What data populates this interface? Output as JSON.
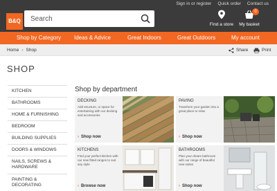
{
  "header": {
    "logo": "B&Q",
    "search_placeholder": "Search",
    "toplinks": [
      "Sign in or register",
      "Quick order",
      "Contact us"
    ],
    "find_store": "Find a store",
    "basket": "My basket",
    "basket_count": "0"
  },
  "nav": [
    "Shop by Category",
    "Ideas & Advice",
    "Great Indoors",
    "Great Outdoors",
    "My account"
  ],
  "breadcrumb": [
    "Home",
    "Shop"
  ],
  "share": "Share",
  "print": "Print",
  "page_title": "SHOP",
  "sidebar": [
    "KITCHEN",
    "BATHROOMS",
    "HOME & FURNISHING",
    "BEDROOM",
    "BUILDING SUPPLIES",
    "DOORS & WINDOWS",
    "NAILS, SCREWS & HARDWARE",
    "PAINTING & DECORATING"
  ],
  "dept_title": "Shop by department",
  "cards": [
    {
      "title": "DECKING",
      "desc": "Add structure, or space for entertaining with our decking and accessories",
      "link": "Shop now"
    },
    {
      "title": "PAVING",
      "desc": "Transform your garden into a great place to relax",
      "link": "Shop now"
    },
    {
      "title": "KITCHENS",
      "desc": "Find your perfect kitchen with our new fitted ranges to suit any style",
      "link": "Browse now"
    },
    {
      "title": "BATHROOMS",
      "desc": "Plan your dream bathroom with our range of beautiful new suites",
      "link": "Shop now"
    }
  ],
  "colors": {
    "brand": "#f26722",
    "header": "#3b3b3b"
  }
}
